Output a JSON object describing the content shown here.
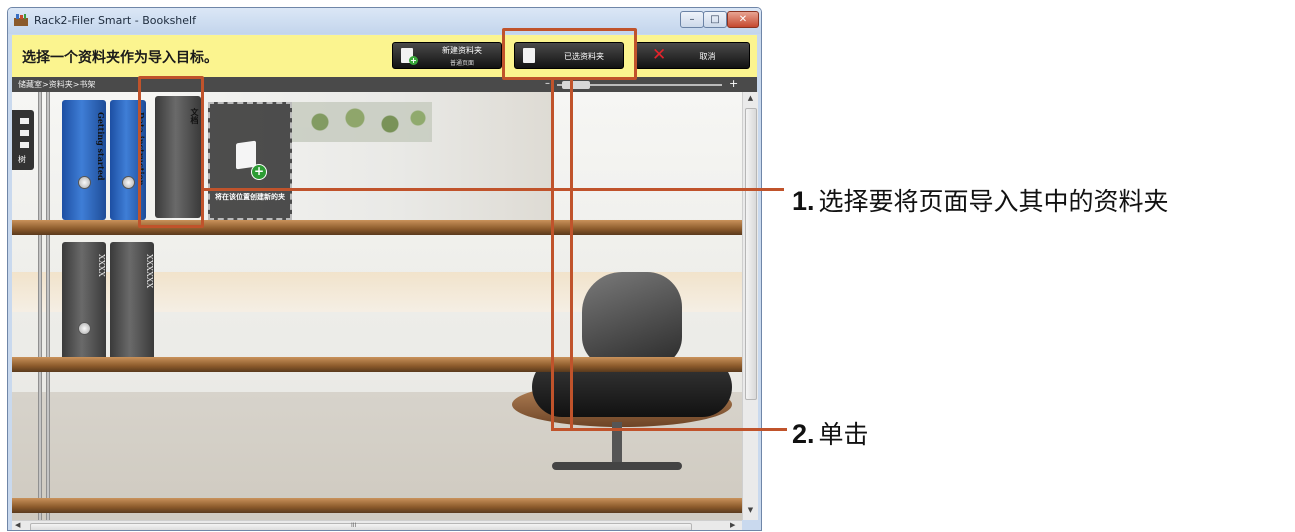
{
  "window": {
    "title": "Rack2-Filer Smart - Bookshelf",
    "controls": {
      "minimize": "–",
      "maximize": "□",
      "close": "✕"
    }
  },
  "toolbar": {
    "instruction": "选择一个资料夹作为导入目标。",
    "new_binder": {
      "label": "新建资料夹",
      "sublabel": "普通页面"
    },
    "selected_binder": {
      "label": "已选资料夹"
    },
    "cancel": {
      "label": "取消"
    }
  },
  "pathbar": {
    "breadcrumb": "储藏室>资料夹>书架",
    "zoom_minus": "–",
    "zoom_plus": "+"
  },
  "side_panel": {
    "label": "树"
  },
  "shelves": {
    "top_row": [
      {
        "title": "Getting started",
        "color": "blue"
      },
      {
        "title": "Data instruction",
        "color": "blue"
      },
      {
        "title": "文档",
        "color": "gray"
      }
    ],
    "second_row": [
      {
        "title": "XXXX",
        "color": "gray"
      },
      {
        "title": "XXXXXX",
        "color": "gray"
      }
    ],
    "new_slot_label": "将在该位置创建新的夹"
  },
  "scrollbar": {
    "h_marker": "III"
  },
  "callouts": [
    {
      "number": "1.",
      "text": "选择要将页面导入其中的资料夹"
    },
    {
      "number": "2.",
      "text": "单击"
    }
  ],
  "colors": {
    "accent": "#c0532b",
    "instruction_bar": "#fbf48f"
  }
}
